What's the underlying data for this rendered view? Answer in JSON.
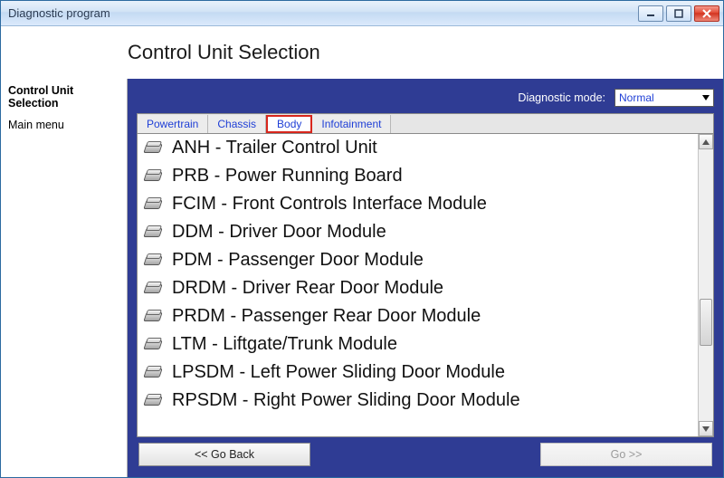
{
  "window": {
    "title": "Diagnostic program"
  },
  "header": {
    "title": "Control Unit Selection"
  },
  "sidebar": {
    "items": [
      {
        "label": "Control Unit Selection",
        "bold": true
      },
      {
        "label": "Main menu",
        "bold": false
      }
    ]
  },
  "diagnostic": {
    "label": "Diagnostic mode:",
    "selected": "Normal"
  },
  "tabs": [
    {
      "label": "Powertrain",
      "active": false
    },
    {
      "label": "Chassis",
      "active": false
    },
    {
      "label": "Body",
      "active": true
    },
    {
      "label": "Infotainment",
      "active": false
    }
  ],
  "modules": [
    {
      "label": "ANH - Trailer Control Unit"
    },
    {
      "label": "PRB - Power Running Board"
    },
    {
      "label": "FCIM - Front Controls Interface Module"
    },
    {
      "label": "DDM - Driver Door Module"
    },
    {
      "label": "PDM - Passenger Door Module"
    },
    {
      "label": "DRDM - Driver Rear Door Module"
    },
    {
      "label": "PRDM - Passenger Rear Door Module"
    },
    {
      "label": "LTM - Liftgate/Trunk Module"
    },
    {
      "label": "LPSDM - Left Power Sliding Door Module"
    },
    {
      "label": "RPSDM - Right Power Sliding Door Module"
    }
  ],
  "footer": {
    "back": "<< Go Back",
    "next": "Go >>"
  }
}
